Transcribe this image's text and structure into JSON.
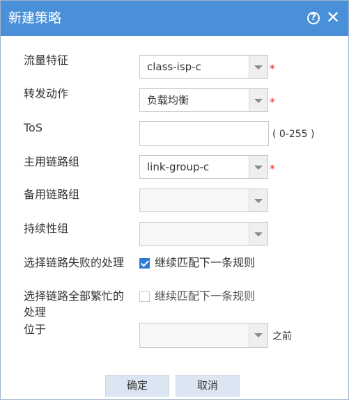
{
  "dialog": {
    "title": "新建策略",
    "help_icon": "?",
    "close_icon": "✕",
    "title_bar_color": "#4a90d9"
  },
  "form": {
    "traffic_feature": {
      "label": "流量特征",
      "value": "class-isp-c",
      "required_mark": "*"
    },
    "forward_action": {
      "label": "转发动作",
      "value": "负载均衡",
      "required_mark": "*"
    },
    "tos": {
      "label": "ToS",
      "value": "",
      "range_hint": "( 0-255 )"
    },
    "primary_link_group": {
      "label": "主用链路组",
      "value": "link-group-c",
      "required_mark": "*"
    },
    "backup_link_group": {
      "label": "备用链路组",
      "value": ""
    },
    "persistence_group": {
      "label": "持续性组",
      "value": ""
    },
    "link_failure": {
      "label": "选择链路失败的处理",
      "checkbox_label": "继续匹配下一条规则",
      "checked": true
    },
    "link_busy": {
      "label_line1": "选择链路全部繁忙的",
      "label_line2": "处理",
      "checkbox_label": "继续匹配下一条规则",
      "checked": false
    },
    "position": {
      "label": "位于",
      "value": "",
      "suffix": "之前"
    }
  },
  "buttons": {
    "confirm": "确定",
    "cancel": "取消"
  }
}
